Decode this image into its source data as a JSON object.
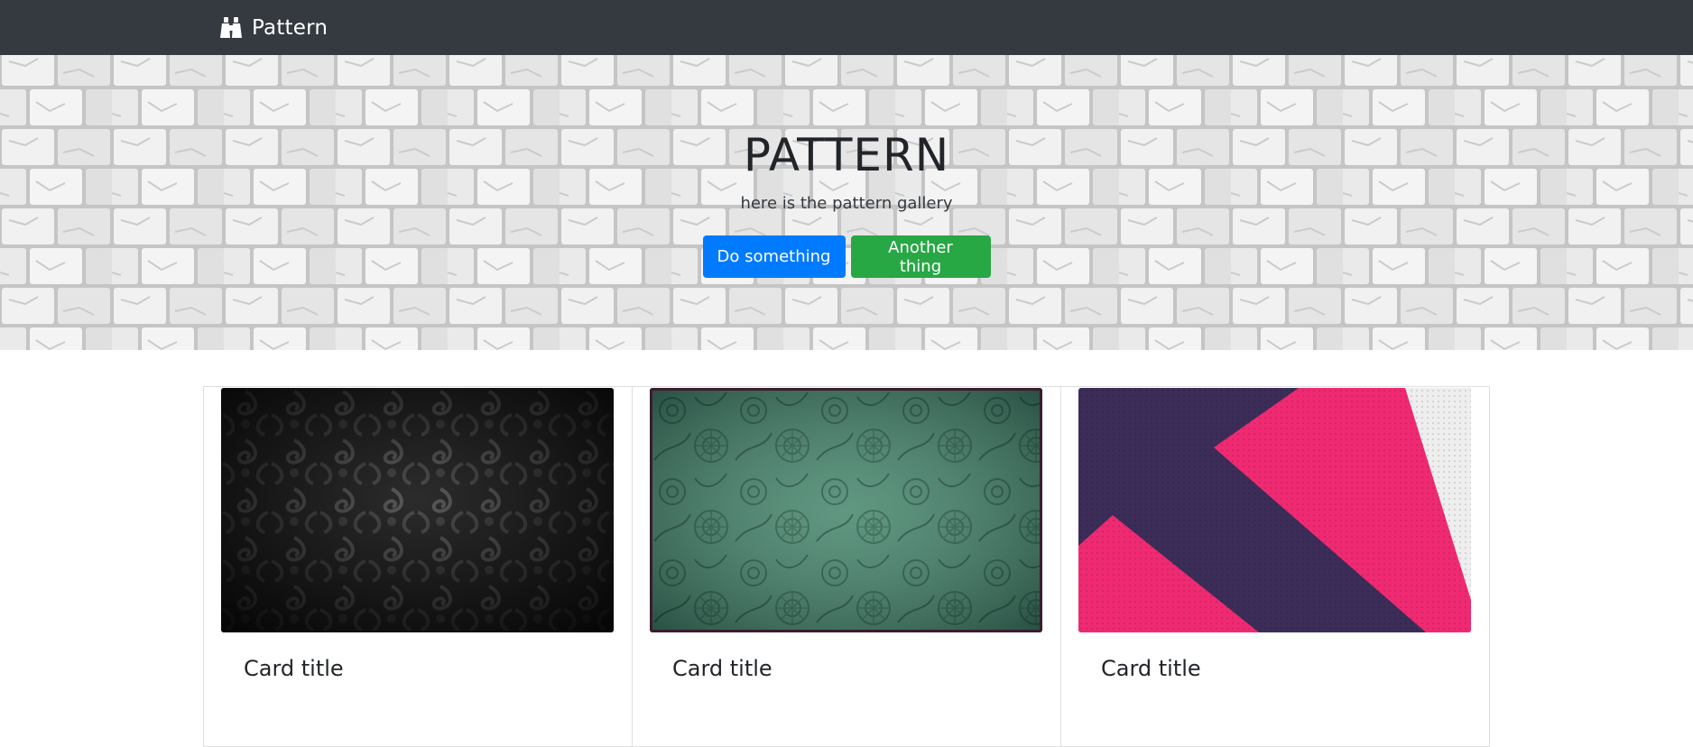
{
  "navbar": {
    "brand": "Pattern",
    "brand_icon": "binoculars-icon",
    "background": "#343a40"
  },
  "hero": {
    "title": "PATTERN",
    "subtitle": "here is the pattern gallery",
    "primary_button": "Do something",
    "secondary_button": "Another thing",
    "primary_color": "#007bff",
    "secondary_color": "#28a745"
  },
  "cards": [
    {
      "title": "Card title",
      "image": "dark-damask-pattern"
    },
    {
      "title": "Card title",
      "image": "teal-floral-doodle-pattern"
    },
    {
      "title": "Card title",
      "image": "purple-pink-chevron-pattern"
    }
  ]
}
